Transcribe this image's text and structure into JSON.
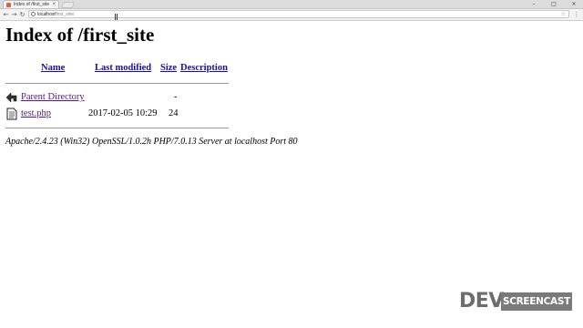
{
  "browser": {
    "tab_title": "Index of /first_site",
    "tab_close": "×",
    "url_host": "localhost",
    "url_path": "/first_site/",
    "controls": {
      "minimize": "–",
      "maximize": "□",
      "close": "×"
    },
    "nav": {
      "back": "←",
      "forward": "→",
      "reload": "↻"
    },
    "star": "☆",
    "menu": "⋮"
  },
  "page": {
    "heading": "Index of /first_site",
    "columns": {
      "name": "Name",
      "last_modified": "Last modified",
      "size": "Size",
      "description": "Description"
    },
    "parent": {
      "name": "Parent Directory",
      "size": "-",
      "icon": "back-arrow-icon"
    },
    "files": [
      {
        "name": "test.php",
        "last_modified": "2017-02-05 10:29",
        "size": "24",
        "icon": "text-file-icon"
      }
    ],
    "server_signature": "Apache/2.4.23 (Win32) OpenSSL/1.0.2h PHP/7.0.13 Server at localhost Port 80"
  },
  "watermark": {
    "left": "DEV",
    "right": "SCREENCAST"
  }
}
